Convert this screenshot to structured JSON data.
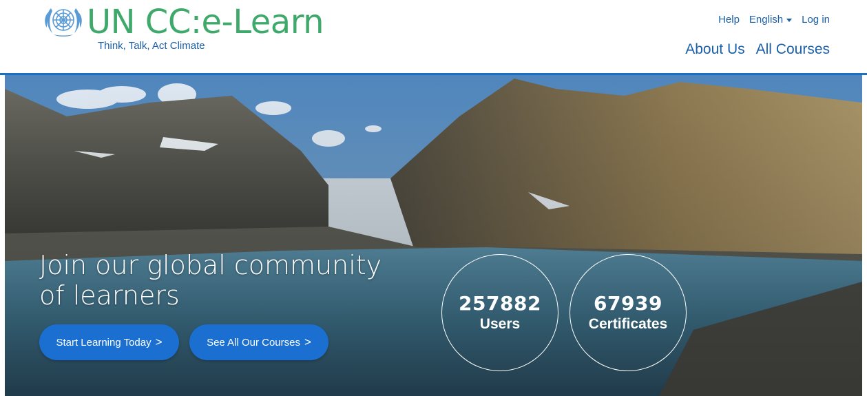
{
  "header": {
    "brand": "UN CC:e-Learn",
    "tagline": "Think, Talk, Act Climate",
    "logo_icon": "un-emblem-icon",
    "topnav": {
      "help": "Help",
      "language": "English",
      "login": "Log in"
    },
    "mainnav": {
      "about": "About Us",
      "courses": "All Courses"
    }
  },
  "hero": {
    "title_line1": "Join our global community",
    "title_line2": "of learners",
    "buttons": {
      "start": "Start Learning Today",
      "courses": "See All Our Courses",
      "chevron": ">"
    },
    "stats": [
      {
        "value": "257882",
        "label": "Users"
      },
      {
        "value": "67939",
        "label": "Certificates"
      }
    ]
  },
  "colors": {
    "brand_green": "#3fa96b",
    "link_blue": "#1a5fa8",
    "button_blue": "#1a6fd1",
    "divider_blue": "#1e6fc0"
  }
}
